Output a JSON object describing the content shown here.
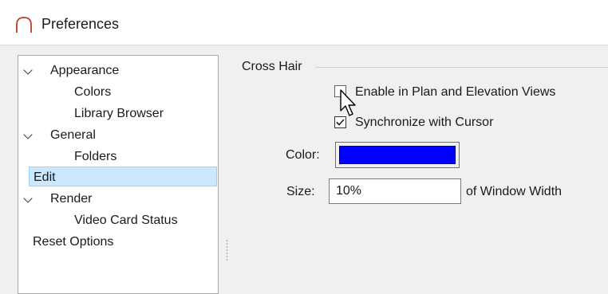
{
  "window": {
    "title": "Preferences",
    "icon": "arch-icon"
  },
  "tree": {
    "items": [
      {
        "label": "Appearance",
        "level": 0,
        "expandable": true
      },
      {
        "label": "Colors",
        "level": 1
      },
      {
        "label": "Library Browser",
        "level": 1
      },
      {
        "label": "General",
        "level": 0,
        "expandable": true
      },
      {
        "label": "Folders",
        "level": 1
      },
      {
        "label": "Edit",
        "level": 0,
        "selected": true
      },
      {
        "label": "Render",
        "level": 0,
        "expandable": true
      },
      {
        "label": "Video Card Status",
        "level": 1
      },
      {
        "label": "Reset Options",
        "level": 0
      }
    ]
  },
  "crosshair": {
    "group_label": "Cross Hair",
    "enable_label": "Enable in Plan and Elevation Views",
    "enable_checked": false,
    "sync_label": "Synchronize with Cursor",
    "sync_checked": true,
    "color_label": "Color:",
    "color_value": "#0000ff",
    "size_label": "Size:",
    "size_value": "10%",
    "size_suffix": "of Window Width"
  },
  "colors": {
    "accent": "#cce8ff",
    "selection_border": "#99d1ff",
    "icon": "#c0392b"
  }
}
